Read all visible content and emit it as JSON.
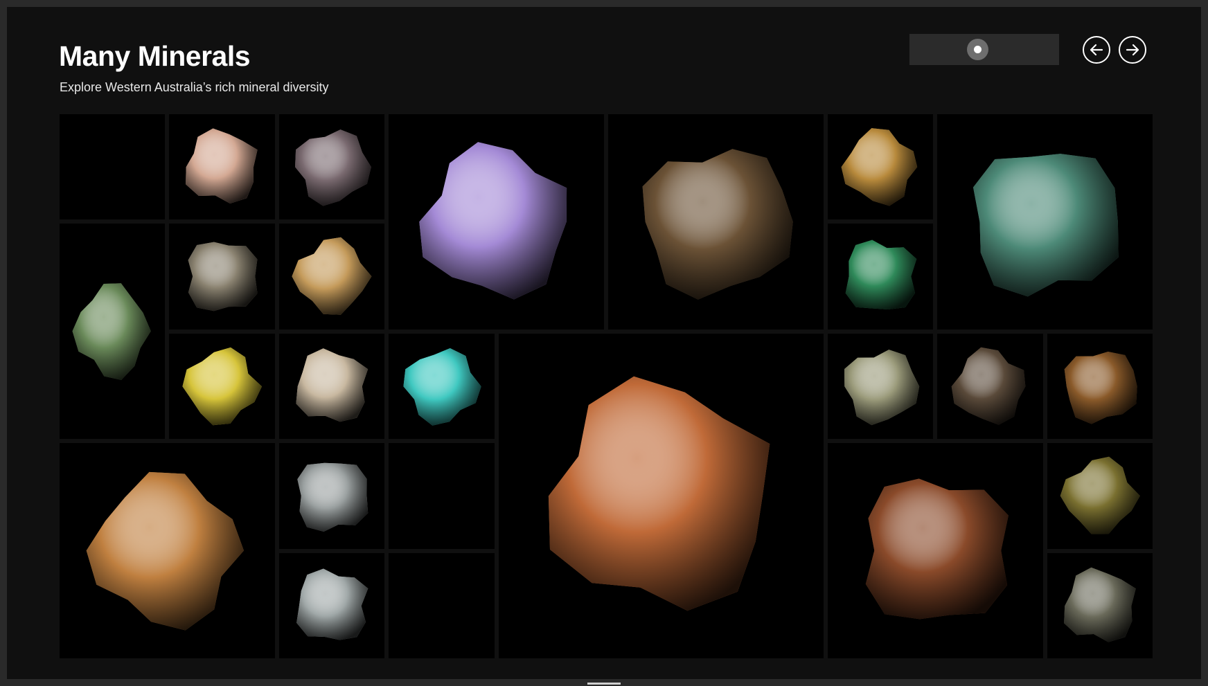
{
  "header": {
    "title": "Many Minerals",
    "subtitle": "Explore Western Australia’s rich mineral diversity"
  },
  "navigation": {
    "prev_icon": "arrow-left-icon",
    "next_icon": "arrow-right-icon",
    "scroll_position": 0.45
  },
  "colors": {
    "background": "#101010",
    "tile": "#000000",
    "scroll_track": "#2b2b2b",
    "scroll_thumb": "#6e6e6e"
  },
  "specimens": [
    {
      "id": "empty-1",
      "icon": "empty-tile",
      "color": "#000000"
    },
    {
      "id": "mineral-2",
      "icon": "mineral-specimen-icon",
      "color": "#d3a893"
    },
    {
      "id": "mineral-3",
      "icon": "mineral-specimen-icon",
      "color": "#7a6a70"
    },
    {
      "id": "mineral-4",
      "icon": "mineral-specimen-icon",
      "color": "#a48ad6"
    },
    {
      "id": "mineral-5",
      "icon": "mineral-specimen-icon",
      "color": "#6b5236"
    },
    {
      "id": "mineral-6",
      "icon": "mineral-specimen-icon",
      "color": "#b88a3c"
    },
    {
      "id": "mineral-7",
      "icon": "mineral-specimen-icon",
      "color": "#4d8a78"
    },
    {
      "id": "mineral-8",
      "icon": "mineral-specimen-icon",
      "color": "#6a8a5a"
    },
    {
      "id": "mineral-9",
      "icon": "mineral-specimen-icon",
      "color": "#8a8270"
    },
    {
      "id": "mineral-10",
      "icon": "mineral-specimen-icon",
      "color": "#c49a5a"
    },
    {
      "id": "mineral-11",
      "icon": "mineral-specimen-icon",
      "color": "#2f8a5a"
    },
    {
      "id": "mineral-12",
      "icon": "mineral-specimen-icon",
      "color": "#d6c43a"
    },
    {
      "id": "mineral-13",
      "icon": "mineral-specimen-icon",
      "color": "#c8b8a0"
    },
    {
      "id": "mineral-14",
      "icon": "mineral-specimen-icon",
      "color": "#3fc8c0"
    },
    {
      "id": "mineral-15",
      "icon": "mineral-specimen-icon",
      "color": "#c06a38"
    },
    {
      "id": "mineral-16",
      "icon": "mineral-specimen-icon",
      "color": "#9a9a7a"
    },
    {
      "id": "mineral-17",
      "icon": "mineral-specimen-icon",
      "color": "#5a4a3a"
    },
    {
      "id": "mineral-18",
      "icon": "mineral-specimen-icon",
      "color": "#8a5a2a"
    },
    {
      "id": "mineral-19",
      "icon": "mineral-specimen-icon",
      "color": "#c08040"
    },
    {
      "id": "mineral-20",
      "icon": "mineral-specimen-icon",
      "color": "#9aa0a0"
    },
    {
      "id": "empty-21",
      "icon": "empty-tile",
      "color": "#000000"
    },
    {
      "id": "mineral-22",
      "icon": "mineral-specimen-icon",
      "color": "#8a4a2a"
    },
    {
      "id": "mineral-23",
      "icon": "mineral-specimen-icon",
      "color": "#7a7030"
    },
    {
      "id": "mineral-24",
      "icon": "mineral-specimen-icon",
      "color": "#a0a8a8"
    },
    {
      "id": "empty-25",
      "icon": "empty-tile",
      "color": "#000000"
    },
    {
      "id": "mineral-26",
      "icon": "mineral-specimen-icon",
      "color": "#6a6a5a"
    }
  ]
}
